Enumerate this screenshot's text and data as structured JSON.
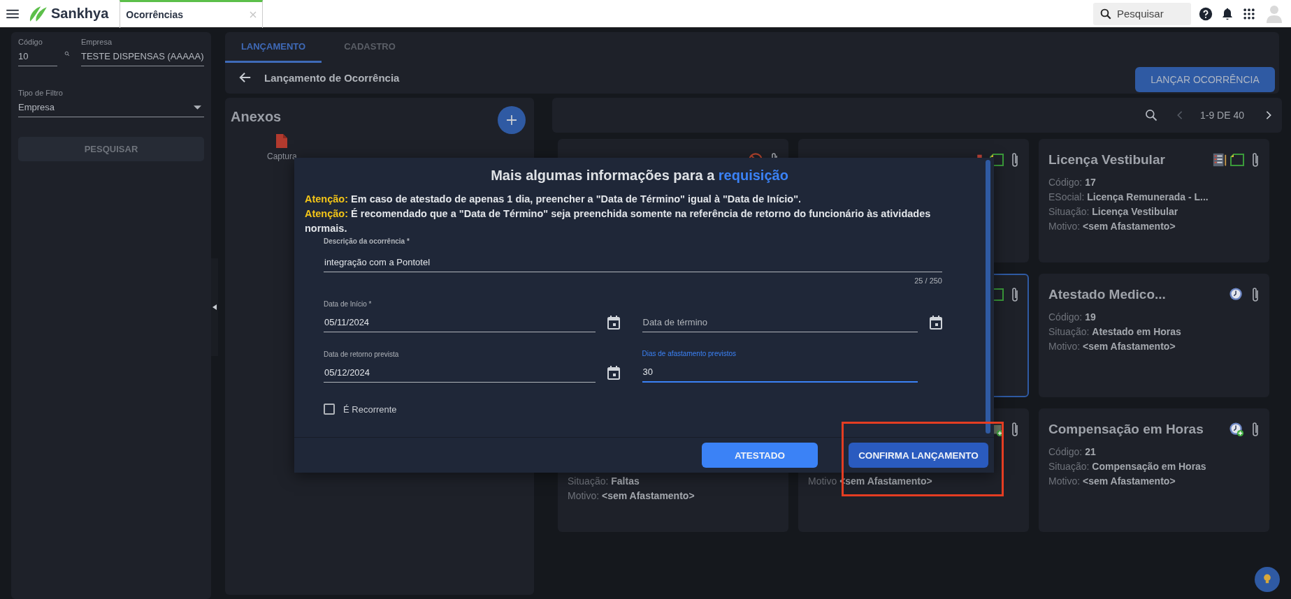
{
  "topbar": {
    "brand": "Sankhya",
    "tab": {
      "label": "Ocorrências",
      "selected": true
    },
    "search": {
      "placeholder": "Pesquisar"
    }
  },
  "filter": {
    "codigo": {
      "label": "Código",
      "value": "10"
    },
    "empresa": {
      "label": "Empresa",
      "value": "TESTE DISPENSAS (AAAAA)"
    },
    "tipo": {
      "label": "Tipo de Filtro",
      "value": "Empresa"
    },
    "button": "PESQUISAR"
  },
  "tabs": [
    {
      "label": "LANÇAMENTO",
      "selected": true
    },
    {
      "label": "CADASTRO",
      "selected": false
    }
  ],
  "page_title": "Lançamento de Ocorrência",
  "launch_button": "LANÇAR OCORRÊNCIA",
  "attachments": {
    "title": "Anexos",
    "files": [
      {
        "name": "Captura"
      }
    ]
  },
  "pager": {
    "range": "1-9 DE 40"
  },
  "cards": [
    {
      "selected": false,
      "icons": [
        {
          "kind": "blocked"
        },
        {
          "kind": "clip"
        }
      ]
    },
    {
      "selected": false,
      "icons": [
        {
          "kind": "sheet"
        },
        {
          "kind": "note"
        },
        {
          "kind": "clip"
        }
      ]
    },
    {
      "title": "Licença Vestibular",
      "selected": false,
      "icons": [
        {
          "kind": "form"
        },
        {
          "kind": "note"
        },
        {
          "kind": "clip"
        }
      ],
      "fields": [
        {
          "label": "Código:",
          "value": "17"
        },
        {
          "label": "ESocial:",
          "value": "Licença Remunerada - L..."
        },
        {
          "label": "Situação:",
          "value": "Licença Vestibular"
        },
        {
          "label": "Motivo:",
          "value": "<sem Afastamento>"
        }
      ]
    },
    {
      "selected": true,
      "icons": [
        {
          "kind": "note"
        },
        {
          "kind": "clip"
        }
      ]
    },
    {
      "title": "Atestado Medico...",
      "selected": false,
      "icons": [
        {
          "kind": "clock"
        },
        {
          "kind": "clip"
        }
      ],
      "fields": [
        {
          "label": "Código:",
          "value": "19"
        },
        {
          "label": "Situação:",
          "value": "Atestado em Horas"
        },
        {
          "label": "Motivo:",
          "value": "<sem Afastamento>"
        }
      ]
    },
    {
      "selected": false,
      "fields": [
        {
          "label": "Situação:",
          "value": "Faltas"
        },
        {
          "label": "Motivo:",
          "value": "<sem Afastamento>"
        }
      ]
    },
    {
      "selected": false,
      "icons": [
        {
          "kind": "image"
        },
        {
          "kind": "clip"
        }
      ],
      "fields": [
        {
          "label": "Motivo",
          "value": "<sem Afastamento>"
        }
      ]
    },
    {
      "title": "Compensação em Horas",
      "selected": false,
      "icons": [
        {
          "kind": "clockplus"
        },
        {
          "kind": "clip"
        }
      ],
      "fields": [
        {
          "label": "Código:",
          "value": "21"
        },
        {
          "label": "Situação:",
          "value": "Compensação em Horas"
        },
        {
          "label": "Motivo:",
          "value": "<sem Afastamento>"
        }
      ]
    }
  ],
  "dialog": {
    "title": "Mais algumas informações para a",
    "title_highlight": "requisição",
    "warnings": [
      {
        "label": "Atenção:",
        "text": "Em caso de atestado de apenas 1 dia, preencher a \"Data de Término\" igual à \"Data de Início\"."
      },
      {
        "label": "Atenção:",
        "text": "É recomendado que a \"Data de Término\" seja preenchida somente na referência de retorno do funcionário às atividades normais."
      }
    ],
    "description": {
      "label": "Descrição da ocorrência *",
      "value": "integração com a Pontotel",
      "counter": "25 / 250"
    },
    "fields": [
      {
        "kind": "date",
        "label": "Data de Início *",
        "value": "05/11/2024",
        "focused": false
      },
      {
        "kind": "date",
        "placeholder": "Data de término",
        "focused": false
      },
      {
        "kind": "date",
        "label": "Data de retorno prevista",
        "value": "05/12/2024",
        "focused": false
      },
      {
        "kind": "number",
        "label": "Dias de afastamento previstos",
        "value": "30",
        "focused": true
      }
    ],
    "recurring": {
      "label": "É Recorrente",
      "checked": false
    },
    "buttons": [
      {
        "label": "ATESTADO",
        "kind": "secondary"
      },
      {
        "label": "CONFIRMA LANÇAMENTO",
        "kind": "primary",
        "highlighted": true
      }
    ]
  }
}
